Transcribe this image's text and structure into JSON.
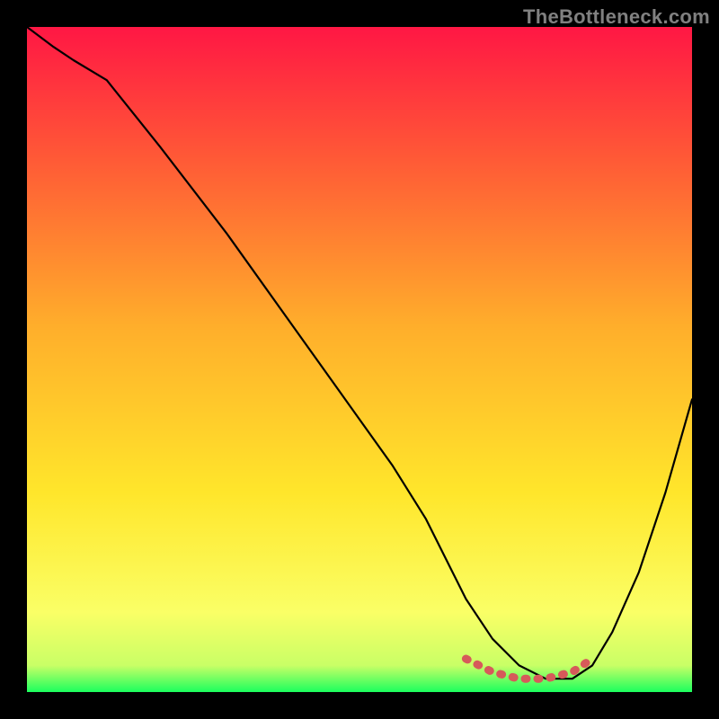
{
  "watermark": "TheBottleneck.com",
  "colors": {
    "gradient_stops": [
      {
        "offset": "0%",
        "color": "#ff1744"
      },
      {
        "offset": "20%",
        "color": "#ff5a36"
      },
      {
        "offset": "45%",
        "color": "#ffae2b"
      },
      {
        "offset": "70%",
        "color": "#ffe62b"
      },
      {
        "offset": "88%",
        "color": "#faff66"
      },
      {
        "offset": "96%",
        "color": "#c9ff66"
      },
      {
        "offset": "100%",
        "color": "#1bff5e"
      }
    ],
    "curve_color": "#000000",
    "marker_color": "#d65a5a",
    "background": "#000000"
  },
  "chart_data": {
    "type": "line",
    "title": "",
    "xlabel": "",
    "ylabel": "",
    "xlim": [
      0,
      100
    ],
    "ylim": [
      0,
      100
    ],
    "series": [
      {
        "name": "bottleneck-curve",
        "x": [
          0,
          4,
          7,
          12,
          20,
          30,
          40,
          50,
          55,
          60,
          63,
          66,
          70,
          74,
          78,
          82,
          85,
          88,
          92,
          96,
          100
        ],
        "y": [
          100,
          97,
          95,
          92,
          82,
          69,
          55,
          41,
          34,
          26,
          20,
          14,
          8,
          4,
          2,
          2,
          4,
          9,
          18,
          30,
          44
        ]
      },
      {
        "name": "optimal-region",
        "x": [
          66,
          70,
          74,
          78,
          82,
          85
        ],
        "y": [
          5,
          3,
          2,
          2,
          3,
          5
        ]
      }
    ],
    "annotations": []
  }
}
